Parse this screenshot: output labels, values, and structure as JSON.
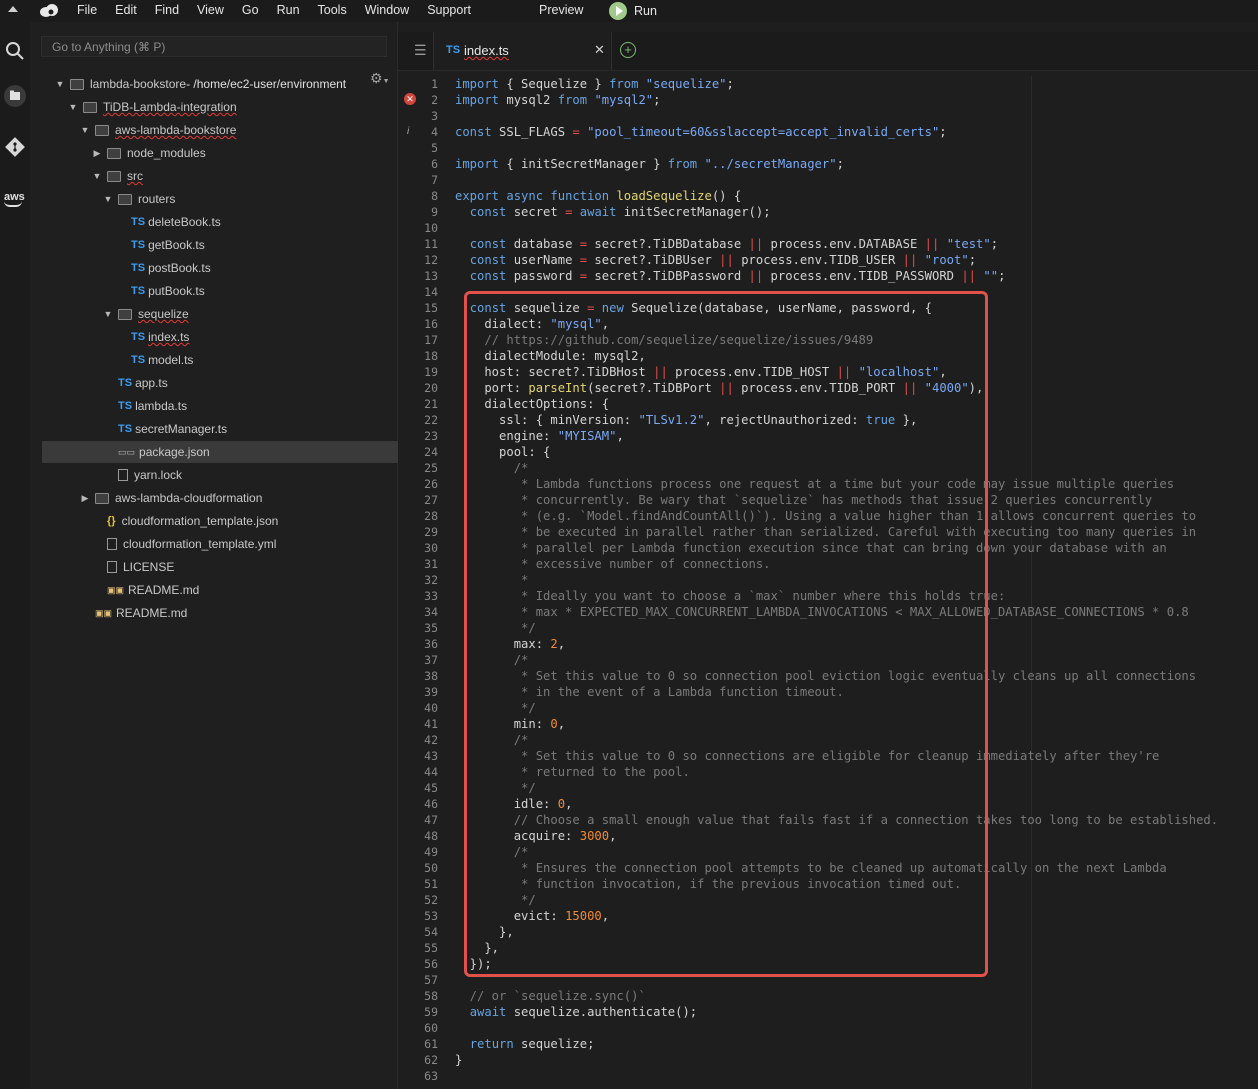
{
  "menubar": {
    "items": [
      "File",
      "Edit",
      "Find",
      "View",
      "Go",
      "Run",
      "Tools",
      "Window",
      "Support"
    ],
    "preview": "Preview",
    "run": "Run",
    "logo_icon": "cloud9-icon"
  },
  "activity": {
    "icons": [
      "search-icon",
      "files-icon",
      "git-icon",
      "aws-icon"
    ],
    "aws_label": "aws"
  },
  "sidebar": {
    "goto_placeholder": "Go to Anything (⌘ P)",
    "tree": [
      {
        "label": "lambda-bookstore",
        "extra": " - /home/ec2-user/environment",
        "type": "folder",
        "open": true,
        "depth": 0,
        "squig": false
      },
      {
        "label": "TiDB-Lambda-integration",
        "type": "folder",
        "open": true,
        "depth": 1,
        "squig": true
      },
      {
        "label": "aws-lambda-bookstore",
        "type": "folder",
        "open": true,
        "depth": 2,
        "squig": true
      },
      {
        "label": "node_modules",
        "type": "folder",
        "open": false,
        "depth": 3,
        "squig": false
      },
      {
        "label": "src",
        "type": "folder",
        "open": true,
        "depth": 3,
        "squig": true
      },
      {
        "label": "routers",
        "type": "folder",
        "open": true,
        "depth": 4,
        "squig": false
      },
      {
        "label": "deleteBook.ts",
        "type": "ts",
        "depth": 5
      },
      {
        "label": "getBook.ts",
        "type": "ts",
        "depth": 5
      },
      {
        "label": "postBook.ts",
        "type": "ts",
        "depth": 5
      },
      {
        "label": "putBook.ts",
        "type": "ts",
        "depth": 5
      },
      {
        "label": "sequelize",
        "type": "folder",
        "open": true,
        "depth": 4,
        "squig": true
      },
      {
        "label": "index.ts",
        "type": "ts",
        "depth": 5,
        "squig": true
      },
      {
        "label": "model.ts",
        "type": "ts",
        "depth": 5
      },
      {
        "label": "app.ts",
        "type": "ts",
        "depth": 4
      },
      {
        "label": "lambda.ts",
        "type": "ts",
        "depth": 4
      },
      {
        "label": "secretManager.ts",
        "type": "ts",
        "depth": 4
      },
      {
        "label": "package.json",
        "type": "pkg",
        "depth": 4,
        "selected": true
      },
      {
        "label": "yarn.lock",
        "type": "doc",
        "depth": 4
      },
      {
        "label": "aws-lambda-cloudformation",
        "type": "folder",
        "open": false,
        "depth": 2
      },
      {
        "label": "cloudformation_template.json",
        "type": "json",
        "depth": 3
      },
      {
        "label": "cloudformation_template.yml",
        "type": "doc",
        "depth": 3
      },
      {
        "label": "LICENSE",
        "type": "doc",
        "depth": 3
      },
      {
        "label": "README.md",
        "type": "md",
        "depth": 3
      },
      {
        "label": "README.md",
        "type": "md",
        "depth": 2
      }
    ]
  },
  "editor": {
    "tab_label": "index.ts",
    "tab_badge": "TS",
    "lines": [
      "import { Sequelize } from \"sequelize\";",
      "import mysql2 from \"mysql2\";",
      "",
      "const SSL_FLAGS = \"pool_timeout=60&sslaccept=accept_invalid_certs\";",
      "",
      "import { initSecretManager } from \"../secretManager\";",
      "",
      "export async function loadSequelize() {",
      "  const secret = await initSecretManager();",
      "",
      "  const database = secret?.TiDBDatabase || process.env.DATABASE || \"test\";",
      "  const userName = secret?.TiDBUser || process.env.TIDB_USER || \"root\";",
      "  const password = secret?.TiDBPassword || process.env.TIDB_PASSWORD || \"\";",
      "",
      "  const sequelize = new Sequelize(database, userName, password, {",
      "    dialect: \"mysql\",",
      "    // https://github.com/sequelize/sequelize/issues/9489",
      "    dialectModule: mysql2,",
      "    host: secret?.TiDBHost || process.env.TIDB_HOST || \"localhost\",",
      "    port: parseInt(secret?.TiDBPort || process.env.TIDB_PORT || \"4000\"),",
      "    dialectOptions: {",
      "      ssl: { minVersion: \"TLSv1.2\", rejectUnauthorized: true },",
      "      engine: \"MYISAM\",",
      "      pool: {",
      "        /*",
      "         * Lambda functions process one request at a time but your code may issue multiple queries",
      "         * concurrently. Be wary that `sequelize` has methods that issue 2 queries concurrently",
      "         * (e.g. `Model.findAndCountAll()`). Using a value higher than 1 allows concurrent queries to",
      "         * be executed in parallel rather than serialized. Careful with executing too many queries in",
      "         * parallel per Lambda function execution since that can bring down your database with an",
      "         * excessive number of connections.",
      "         *",
      "         * Ideally you want to choose a `max` number where this holds true:",
      "         * max * EXPECTED_MAX_CONCURRENT_LAMBDA_INVOCATIONS < MAX_ALLOWED_DATABASE_CONNECTIONS * 0.8",
      "         */",
      "        max: 2,",
      "        /*",
      "         * Set this value to 0 so connection pool eviction logic eventually cleans up all connections",
      "         * in the event of a Lambda function timeout.",
      "         */",
      "        min: 0,",
      "        /*",
      "         * Set this value to 0 so connections are eligible for cleanup immediately after they're",
      "         * returned to the pool.",
      "         */",
      "        idle: 0,",
      "        // Choose a small enough value that fails fast if a connection takes too long to be established.",
      "        acquire: 3000,",
      "        /*",
      "         * Ensures the connection pool attempts to be cleaned up automatically on the next Lambda",
      "         * function invocation, if the previous invocation timed out.",
      "         */",
      "        evict: 15000,",
      "      },",
      "    },",
      "  });",
      "",
      "  // or `sequelize.sync()`",
      "  await sequelize.authenticate();",
      "",
      "  return sequelize;",
      "}",
      ""
    ],
    "highlight_color": "#e0524a"
  }
}
